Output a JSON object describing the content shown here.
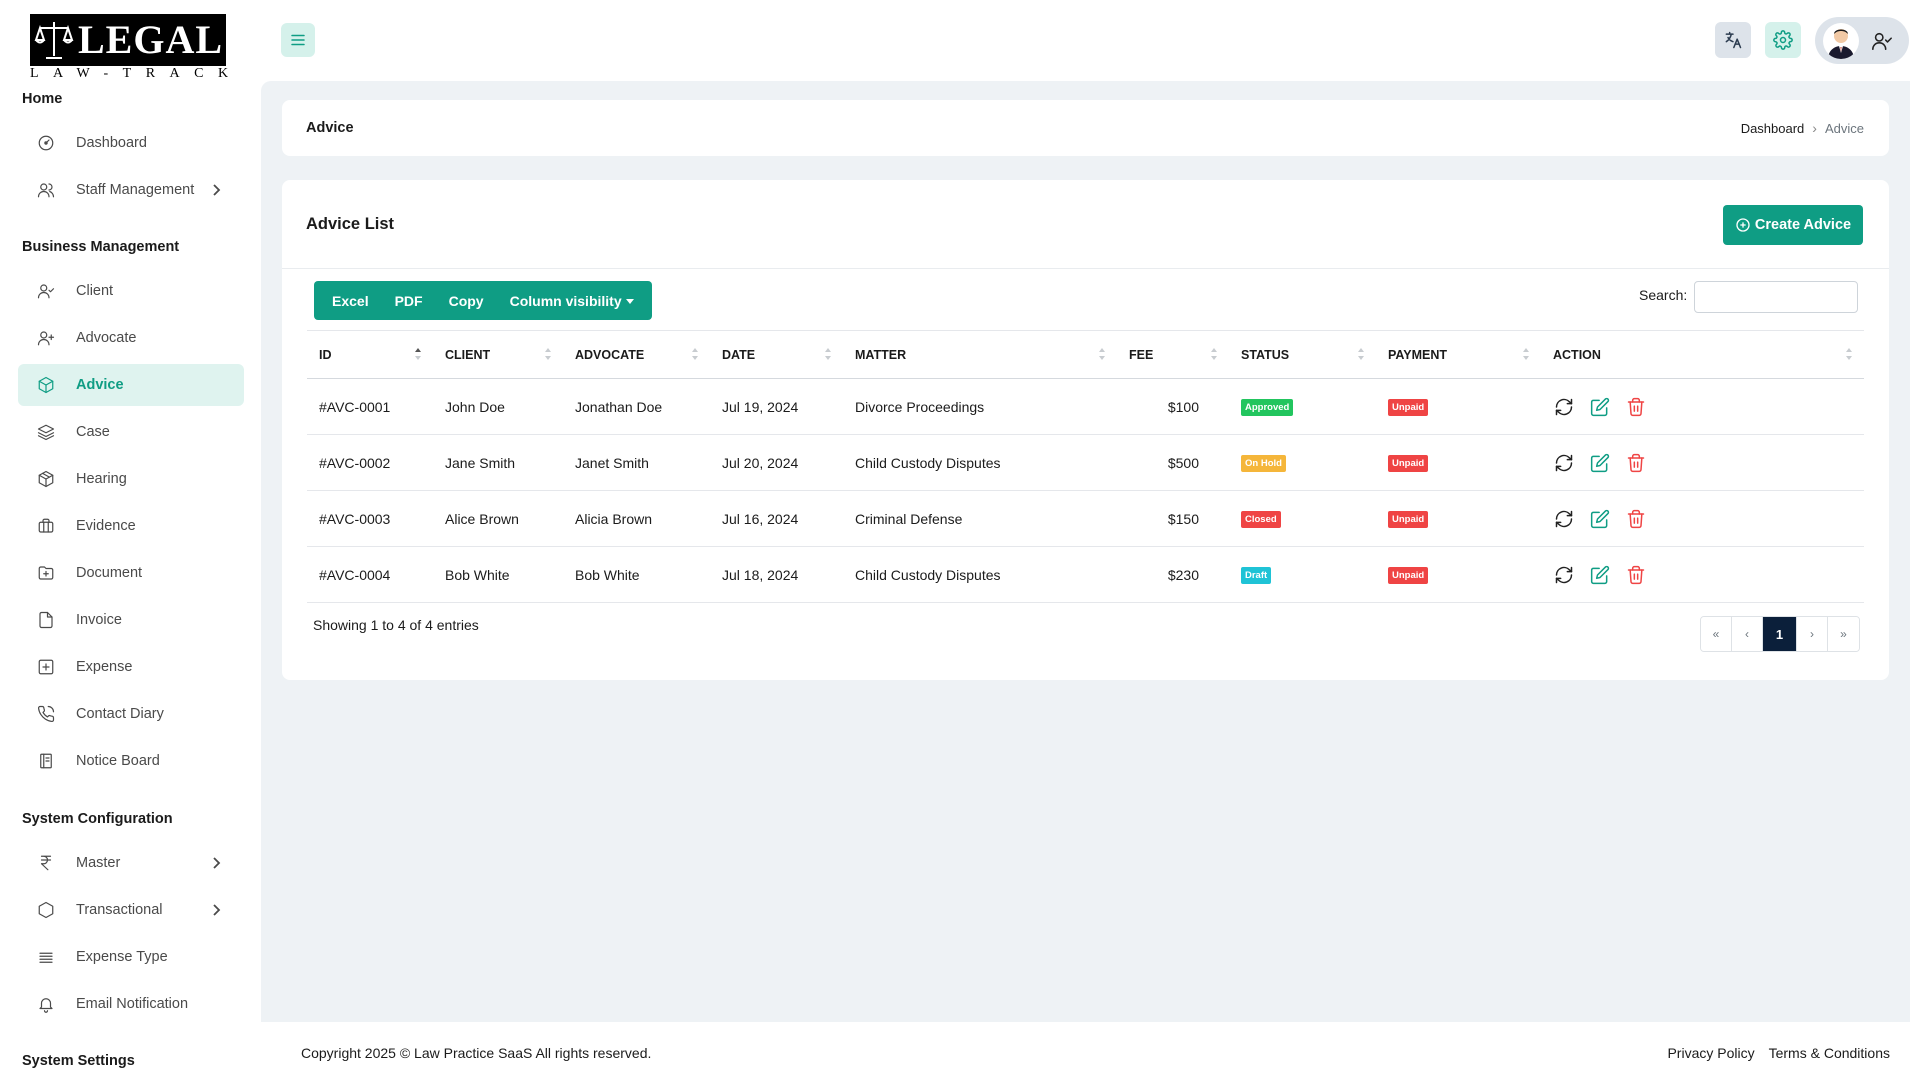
{
  "brand": {
    "logo_text": "LEGAL",
    "logo_sub": "LAW-TRACK"
  },
  "sidebar": {
    "sections": [
      {
        "title": "Home"
      },
      {
        "title": "Business Management"
      },
      {
        "title": "System Configuration"
      },
      {
        "title": "System Settings"
      }
    ],
    "items": [
      {
        "label": "Dashboard",
        "icon": "dashboard-icon"
      },
      {
        "label": "Staff Management",
        "icon": "users-icon",
        "has_children": true
      },
      {
        "label": "Client",
        "icon": "user-check-icon"
      },
      {
        "label": "Advocate",
        "icon": "user-plus-icon"
      },
      {
        "label": "Advice",
        "icon": "cube-icon",
        "active": true
      },
      {
        "label": "Case",
        "icon": "layers-icon"
      },
      {
        "label": "Hearing",
        "icon": "package-icon"
      },
      {
        "label": "Evidence",
        "icon": "briefcase-icon"
      },
      {
        "label": "Document",
        "icon": "folder-plus-icon"
      },
      {
        "label": "Invoice",
        "icon": "file-icon"
      },
      {
        "label": "Expense",
        "icon": "plus-square-icon"
      },
      {
        "label": "Contact Diary",
        "icon": "phone-icon"
      },
      {
        "label": "Notice Board",
        "icon": "notebook-icon"
      },
      {
        "label": "Master",
        "icon": "rupee-icon",
        "has_children": true
      },
      {
        "label": "Transactional",
        "icon": "hexagon-icon",
        "has_children": true
      },
      {
        "label": "Expense Type",
        "icon": "list-icon"
      },
      {
        "label": "Email Notification",
        "icon": "bell-icon"
      }
    ]
  },
  "page_header": {
    "title": "Advice",
    "breadcrumb": [
      "Dashboard",
      "Advice"
    ]
  },
  "list": {
    "title": "Advice List",
    "create_label": "Create Advice",
    "export_buttons": [
      "Excel",
      "PDF",
      "Copy",
      "Column visibility"
    ],
    "search_label": "Search:",
    "search_value": "",
    "columns": [
      "ID",
      "CLIENT",
      "ADVOCATE",
      "DATE",
      "MATTER",
      "FEE",
      "STATUS",
      "PAYMENT",
      "ACTION"
    ],
    "rows": [
      {
        "id": "#AVC-0001",
        "client": "John Doe",
        "advocate": "Jonathan Doe",
        "date": "Jul 19, 2024",
        "matter": "Divorce Proceedings",
        "fee": "$100",
        "status": "Approved",
        "payment": "Unpaid"
      },
      {
        "id": "#AVC-0002",
        "client": "Jane Smith",
        "advocate": "Janet Smith",
        "date": "Jul 20, 2024",
        "matter": "Child Custody Disputes",
        "fee": "$500",
        "status": "On Hold",
        "payment": "Unpaid"
      },
      {
        "id": "#AVC-0003",
        "client": "Alice Brown",
        "advocate": "Alicia Brown",
        "date": "Jul 16, 2024",
        "matter": "Criminal Defense",
        "fee": "$150",
        "status": "Closed",
        "payment": "Unpaid"
      },
      {
        "id": "#AVC-0004",
        "client": "Bob White",
        "advocate": "Bob White",
        "date": "Jul 18, 2024",
        "matter": "Child Custody Disputes",
        "fee": "$230",
        "status": "Draft",
        "payment": "Unpaid"
      }
    ],
    "showing": "Showing 1 to 4 of 4 entries",
    "pagination": [
      "«",
      "‹",
      "1",
      "›",
      "»"
    ],
    "current_page": "1"
  },
  "status_colors": {
    "Approved": "#22c55e",
    "On Hold": "#f5b63a",
    "Closed": "#ef4444",
    "Draft": "#1fc3d6",
    "Unpaid": "#ef4444"
  },
  "colors": {
    "accent": "#0f9d84",
    "accent_light": "#dff3ef",
    "pager_active": "#0b1f3a"
  },
  "footer": {
    "copyright": "Copyright 2025 © Law Practice SaaS All rights reserved.",
    "links": [
      "Privacy Policy",
      "Terms & Conditions"
    ]
  }
}
